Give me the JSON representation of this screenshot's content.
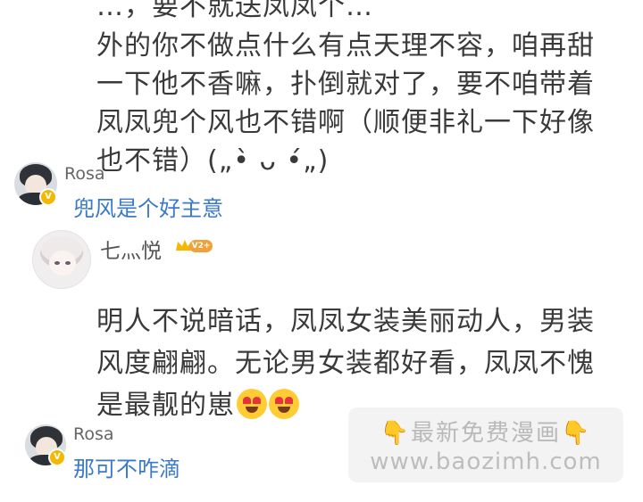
{
  "comment_top": {
    "clipped_line": "…，要不就送凤凤个…",
    "lines": [
      "外的你不做点什么有点天理不容，咱再甜",
      "一下他不香嘛，扑倒就对了，要不咱带着",
      "凤凤兜个风也不错啊（顺便非礼一下好像",
      "也不错）(„•̀ ᴗ •́„)"
    ]
  },
  "reply_1": {
    "username": "Rosa",
    "badge": "V",
    "text": "兜风是个好主意"
  },
  "comment_2": {
    "username": "七灬悦",
    "level_badge": "V2+",
    "lines": [
      "明人不说暗话，凤凤女装美丽动人，男装",
      "风度翩翩。无论男女装都好看，凤凤不愧",
      "是最靓的崽"
    ],
    "emoji": [
      "heart-eyes",
      "heart-eyes"
    ]
  },
  "reply_2": {
    "username": "Rosa",
    "badge": "V",
    "text": "那可不咋滴"
  },
  "watermark": {
    "line1": "最新免费漫画",
    "line2": "www.baozimh.com",
    "pointer_glyph": "👇"
  },
  "colors": {
    "reply_text": "#3a7ac8",
    "badge_gold": "#f5b800",
    "level_orange": "#f0a23a"
  }
}
